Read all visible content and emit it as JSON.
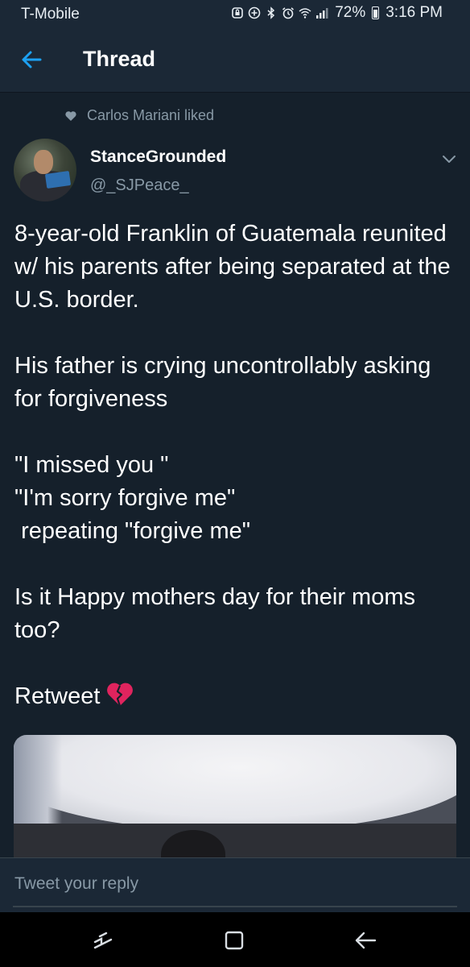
{
  "status_bar": {
    "carrier": "T-Mobile",
    "battery_percent": "72%",
    "time": "3:16 PM",
    "icons": [
      "lock-icon",
      "data-saver-icon",
      "bluetooth-icon",
      "alarm-icon",
      "wifi-icon",
      "signal-icon",
      "battery-icon"
    ]
  },
  "header": {
    "title": "Thread",
    "back_icon": "back-arrow-icon"
  },
  "tweet": {
    "social_context": "Carlos Mariani liked",
    "author_name": "StanceGrounded",
    "author_handle": "@_SJPeace_",
    "text": "8-year-old Franklin of Guatemala reunited w/ his parents after being separated at the U.S. border.\n\nHis father is crying uncontrollably asking for forgiveness\n\n\"I missed you \"\n\"I'm sorry forgive me\"\n repeating \"forgive me\"\n\nIs it Happy mothers day for their moms too?\n\nRetweet",
    "emoji_icon": "broken-heart-icon"
  },
  "reply": {
    "placeholder": "Tweet your reply"
  },
  "nav_bar": {
    "icons": [
      "recent-apps-icon",
      "home-icon",
      "back-icon"
    ]
  },
  "colors": {
    "background": "#15202b",
    "header": "#1b2836",
    "accent": "#1da1f2",
    "secondary_text": "#8899a6",
    "broken_heart": "#e0245e"
  }
}
